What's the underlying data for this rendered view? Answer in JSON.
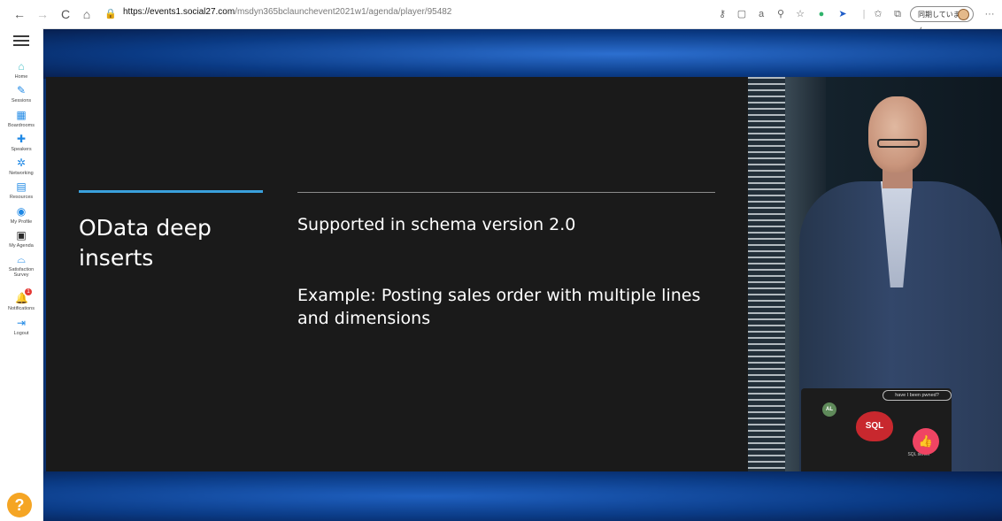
{
  "browser": {
    "back": "←",
    "forward": "→",
    "reload": "C",
    "home": "⌂",
    "url_host": "https://events1.social27.com",
    "url_path": "/msdyn365bclaunchevent2021w1/agenda/player/95482",
    "sync_label": "同期していません",
    "more": "···"
  },
  "sidebar": {
    "items": [
      {
        "label": "Home",
        "icon": "home-icon",
        "color": "#4fc3c9"
      },
      {
        "label": "Sessions",
        "icon": "pen-icon",
        "color": "#1e88e5"
      },
      {
        "label": "Boardrooms",
        "icon": "boardroom-icon",
        "color": "#1e88e5"
      },
      {
        "label": "Speakers",
        "icon": "speaker-icon",
        "color": "#1e88e5"
      },
      {
        "label": "Networking",
        "icon": "networking-icon",
        "color": "#1e88e5"
      },
      {
        "label": "Resources",
        "icon": "resources-icon",
        "color": "#1e88e5"
      },
      {
        "label": "My Profile",
        "icon": "profile-icon",
        "color": "#1e88e5"
      },
      {
        "label": "My Agenda",
        "icon": "agenda-icon",
        "color": "#1e88e5"
      },
      {
        "label": "Satisfaction Survey",
        "icon": "survey-icon",
        "color": "#1e88e5"
      },
      {
        "label": "Notifications",
        "icon": "bell-icon",
        "color": "#1e88e5",
        "badge": "1"
      },
      {
        "label": "Logout",
        "icon": "logout-icon",
        "color": "#1e88e5"
      }
    ],
    "help": "?"
  },
  "slide": {
    "title": "OData deep inserts",
    "points": [
      "Supported in schema version 2.0",
      "Example: Posting sales order with multiple lines and dimensions"
    ]
  },
  "video": {
    "laptop_sticker": "have I been pwned?",
    "laptop_logo": "SQL",
    "laptop_badge": "AL",
    "laptop_note": "SQL server"
  },
  "like_icon": "thumbs-up-icon",
  "accent_color": "#3aa0dc"
}
